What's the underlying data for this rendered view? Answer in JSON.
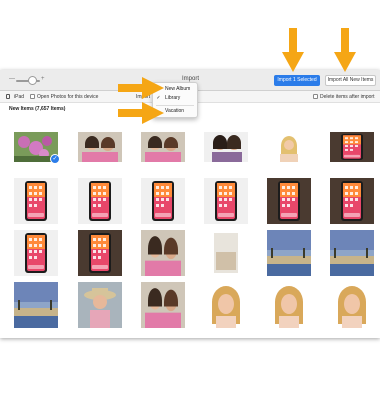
{
  "window": {
    "title": "Import"
  },
  "toolbar": {
    "zoom_minus": "—",
    "zoom_plus": "+",
    "import_selected_label": "Import 1 Selected",
    "import_all_label": "Import All New Items"
  },
  "options": {
    "device_label": "iPad",
    "open_photos_label": "Open Photos for this device",
    "import_to_label": "Import",
    "delete_items_label": "Delete items after import"
  },
  "section": {
    "header": "New Items (7,657 Items)"
  },
  "dropdown": {
    "items": [
      {
        "label": "New Album",
        "checked": false
      },
      {
        "label": "Library",
        "checked": true
      },
      {
        "label": "Vacation",
        "checked": false
      }
    ],
    "check_glyph": "✓"
  },
  "selection": {
    "badge_glyph": "✓",
    "selected_index": 0
  },
  "colors": {
    "accent": "#2b7ce9",
    "arrow": "#f5a615",
    "toolbar_bg": "#ececec"
  },
  "photos": [
    {
      "kind": "flowers"
    },
    {
      "kind": "people-selfie"
    },
    {
      "kind": "people-selfie"
    },
    {
      "kind": "people-dark"
    },
    {
      "kind": "portrait-small"
    },
    {
      "kind": "phone-dark"
    },
    {
      "kind": "phone"
    },
    {
      "kind": "phone"
    },
    {
      "kind": "phone"
    },
    {
      "kind": "phone"
    },
    {
      "kind": "phone-dark"
    },
    {
      "kind": "phone-dark"
    },
    {
      "kind": "phone"
    },
    {
      "kind": "phone-dark"
    },
    {
      "kind": "people-selfie"
    },
    {
      "kind": "document"
    },
    {
      "kind": "landscape"
    },
    {
      "kind": "landscape"
    },
    {
      "kind": "landscape"
    },
    {
      "kind": "portrait-hat"
    },
    {
      "kind": "people-selfie"
    },
    {
      "kind": "portrait"
    },
    {
      "kind": "portrait"
    },
    {
      "kind": "portrait"
    }
  ],
  "icons": {
    "device": "ipad-icon",
    "checkbox": "checkbox-icon",
    "badge": "checkmark-badge-icon",
    "arrow": "down-arrow-icon"
  }
}
